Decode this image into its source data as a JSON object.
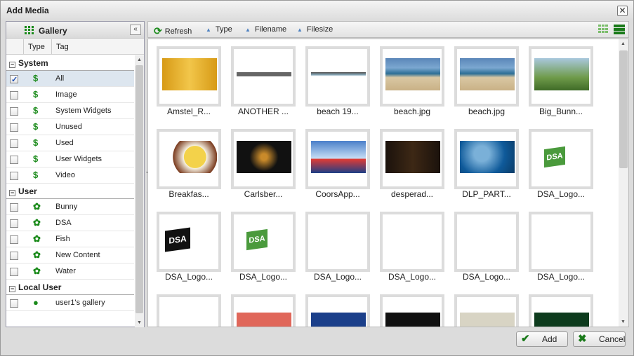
{
  "window": {
    "title": "Add Media",
    "close_glyph": "✕"
  },
  "left": {
    "title": "Gallery",
    "collapse_glyph": "«",
    "col_type": "Type",
    "col_tag": "Tag",
    "groups": [
      {
        "label": "System",
        "icon": "dollar-icon",
        "items": [
          {
            "label": "All",
            "checked": true,
            "selected": true
          },
          {
            "label": "Image"
          },
          {
            "label": "System Widgets"
          },
          {
            "label": "Unused"
          },
          {
            "label": "Used"
          },
          {
            "label": "User Widgets"
          },
          {
            "label": "Video"
          }
        ]
      },
      {
        "label": "User",
        "icon": "gear-icon",
        "items": [
          {
            "label": "Bunny"
          },
          {
            "label": "DSA"
          },
          {
            "label": "Fish"
          },
          {
            "label": "New Content"
          },
          {
            "label": "Water"
          }
        ]
      },
      {
        "label": "Local User",
        "icon": "user-icon",
        "items": [
          {
            "label": "user1's gallery"
          }
        ]
      }
    ]
  },
  "toolbar": {
    "refresh": "Refresh",
    "type": "Type",
    "filename": "Filename",
    "filesize": "Filesize"
  },
  "media": [
    "Amstel_R...",
    "ANOTHER ...",
    "beach 19...",
    "beach.jpg",
    "beach.jpg",
    "Big_Bunn...",
    "Breakfas...",
    "Carlsber...",
    "CoorsApp...",
    "desperad...",
    "DLP_PART...",
    "DSA_Logo...",
    "DSA_Logo...",
    "DSA_Logo...",
    "DSA_Logo...",
    "DSA_Logo...",
    "DSA_Logo...",
    "DSA_Logo...",
    "",
    "",
    "",
    "",
    "",
    ""
  ],
  "footer": {
    "add": "Add",
    "cancel": "Cancel"
  },
  "colors": {
    "accent_green": "#1a8a1a",
    "selection": "#dde6ef"
  }
}
